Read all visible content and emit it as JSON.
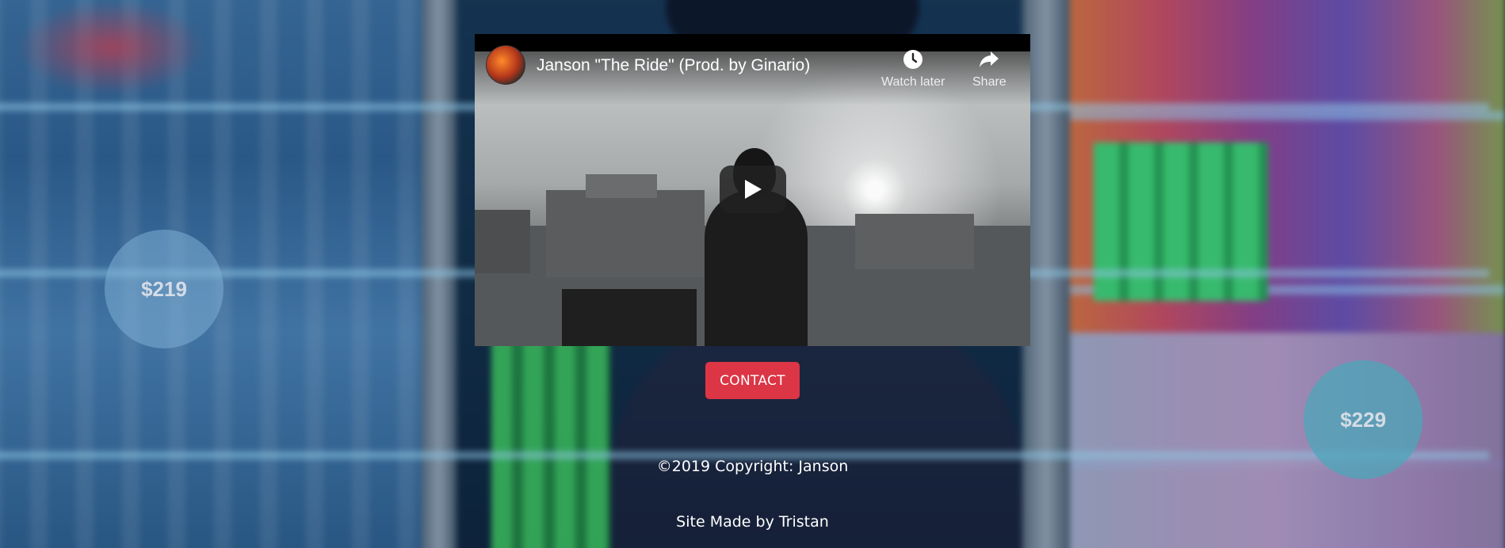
{
  "video": {
    "title": "Janson \"The Ride\" (Prod. by Ginario)",
    "actions": [
      {
        "label": "Watch later",
        "icon": "clock-icon"
      },
      {
        "label": "Share",
        "icon": "share-arrow-icon"
      }
    ],
    "play_icon": "play-icon"
  },
  "contact": {
    "label": "CONTACT",
    "color": "#dc3545"
  },
  "footer": {
    "copyright": "©2019 Copyright: Janson",
    "credit": "Site Made by Tristan"
  },
  "background": {
    "badge_left_price": "$219",
    "badge_right_price": "$229"
  }
}
